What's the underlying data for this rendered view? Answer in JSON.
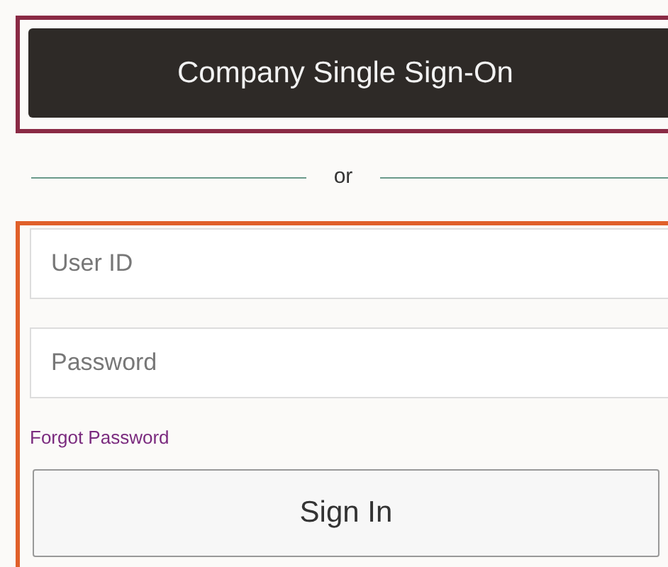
{
  "sso_button": {
    "label": "Company Single Sign-On"
  },
  "divider": {
    "label": "or"
  },
  "fields": [
    {
      "placeholder": "User ID"
    },
    {
      "placeholder": "Password"
    }
  ],
  "forgot_link": {
    "label": "Forgot Password"
  },
  "sign_in_button": {
    "label": "Sign In"
  }
}
